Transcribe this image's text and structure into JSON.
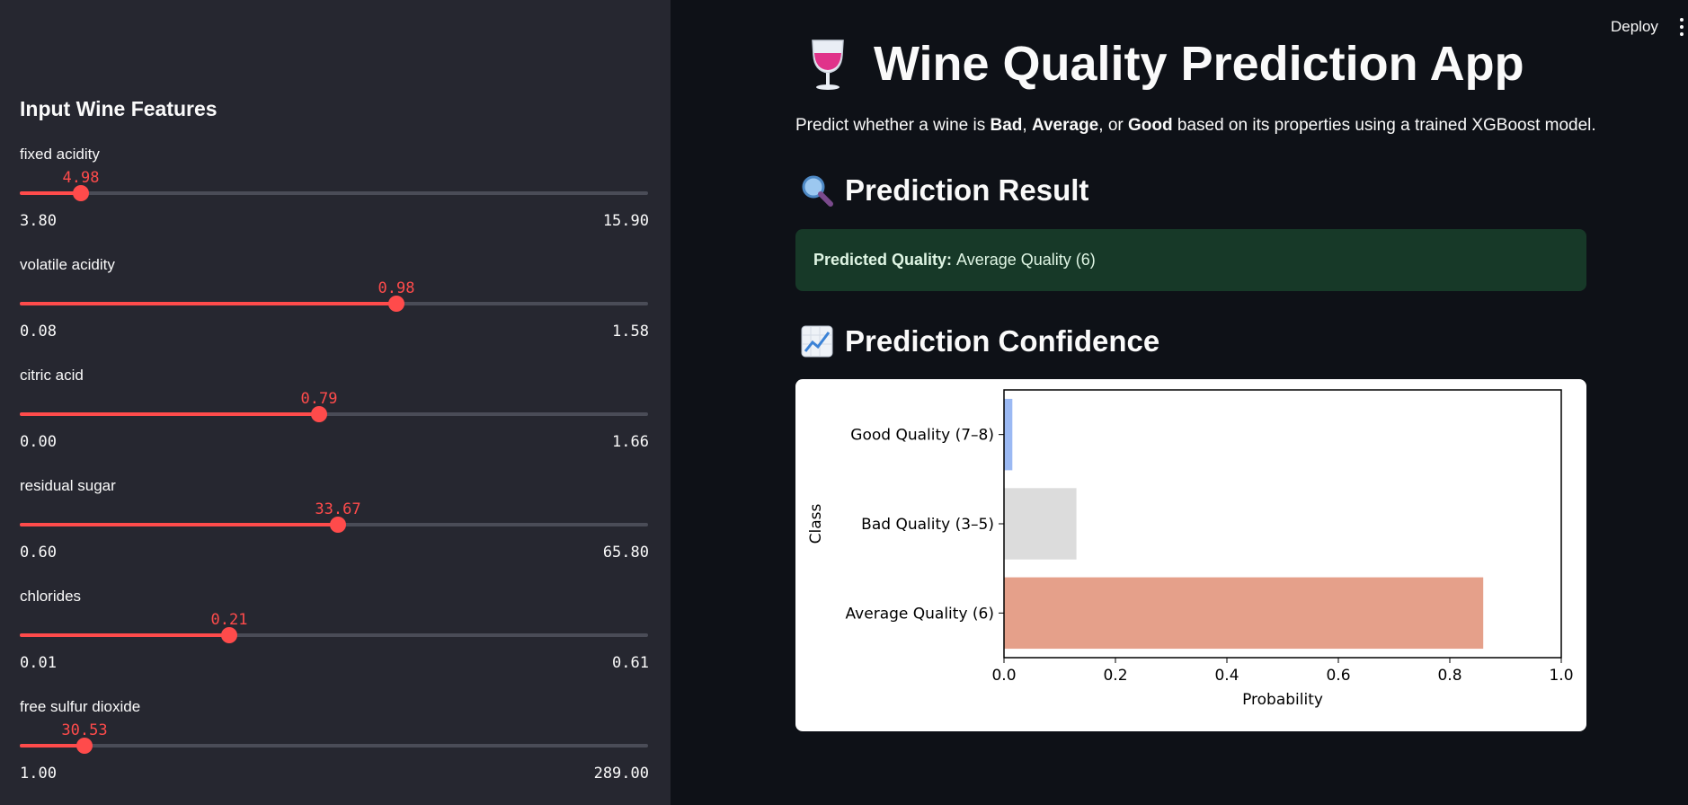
{
  "sidebar": {
    "heading": "Input Wine Features",
    "sliders": [
      {
        "label": "fixed acidity",
        "value": "4.98",
        "min": "3.80",
        "max": "15.90",
        "fraction": 0.0975
      },
      {
        "label": "volatile acidity",
        "value": "0.98",
        "min": "0.08",
        "max": "1.58",
        "fraction": 0.6
      },
      {
        "label": "citric acid",
        "value": "0.79",
        "min": "0.00",
        "max": "1.66",
        "fraction": 0.476
      },
      {
        "label": "residual sugar",
        "value": "33.67",
        "min": "0.60",
        "max": "65.80",
        "fraction": 0.507
      },
      {
        "label": "chlorides",
        "value": "0.21",
        "min": "0.01",
        "max": "0.61",
        "fraction": 0.333
      },
      {
        "label": "free sulfur dioxide",
        "value": "30.53",
        "min": "1.00",
        "max": "289.00",
        "fraction": 0.1025
      }
    ]
  },
  "header": {
    "deploy_label": "Deploy",
    "menu_icon": "more-vertical-icon"
  },
  "main": {
    "title_icon": "wine-glass-icon",
    "title": "Wine Quality Prediction App",
    "intro": {
      "prefix": "Predict whether a wine is ",
      "bad": "Bad",
      "sep1": ", ",
      "average": "Average",
      "sep2": ", or ",
      "good": "Good",
      "suffix": " based on its properties using a trained XGBoost model."
    },
    "result_section": {
      "icon": "magnifying-glass-icon",
      "title": "Prediction Result"
    },
    "result": {
      "label": "Predicted Quality:",
      "value": "Average Quality (6)"
    },
    "confidence_section": {
      "icon": "chart-increasing-icon",
      "title": "Prediction Confidence"
    }
  },
  "colors": {
    "accent": "#ff4b4b",
    "success_bg": "#173928",
    "sidebar_bg": "#262730",
    "app_bg": "#0e1117"
  },
  "chart_data": {
    "type": "bar",
    "orientation": "horizontal",
    "categories": [
      "Good Quality (7–8)",
      "Bad Quality (3–5)",
      "Average Quality (6)"
    ],
    "values": [
      0.015,
      0.13,
      0.86
    ],
    "colors": [
      "#9bb9f3",
      "#dcdcdc",
      "#e5a08a"
    ],
    "xlabel": "Probability",
    "ylabel": "Class",
    "xlim": [
      0,
      1.0
    ],
    "xticks": [
      "0.0",
      "0.2",
      "0.4",
      "0.6",
      "0.8",
      "1.0"
    ],
    "grid": false
  }
}
